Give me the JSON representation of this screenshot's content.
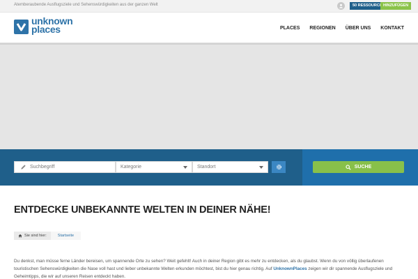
{
  "topbar": {
    "tagline": "Atemberaubende Ausflugsziele und Sehenswürdigkeiten aus der ganzen Welt",
    "resources_label": "50 RESSOURCEN",
    "add_label": "HINZUFÜGEN"
  },
  "header": {
    "logo_line1": "unknown",
    "logo_line2": "places",
    "nav": [
      "PLACES",
      "REGIONEN",
      "ÜBER UNS",
      "KONTAKT"
    ]
  },
  "search": {
    "keyword_placeholder": "Suchbegriff",
    "category_label": "Kategorie",
    "location_label": "Standort",
    "submit_label": "SUCHE"
  },
  "main": {
    "title": "ENTDECKE UNBEKANNTE WELTEN IN DEINER NÄHE!",
    "breadcrumb_prefix": "Sie sind hier:",
    "breadcrumb_current": "Startseite",
    "intro_part1": "Du denkst, man müsse ferne Länder bereisen, um spannende Orte zu sehen? Weit gefehlt! Auch in deiner Region gibt es mehr zu entdecken, als du glaubst. Wenn du von völlig überlaufenen touristischen Sehenswürdigkeiten die Nase voll hast und lieber unbekannte Welten erkunden möchtest, bist du hier genau richtig. Auf ",
    "intro_brand": "UnknownPlaces",
    "intro_part2": " zeigen wir dir spannende Ausflugsziele und Geheimtipps, die wir auf unseren Reisen entdeckt haben."
  },
  "colors": {
    "brand_blue": "#2e73a8",
    "search_band": "#1f6fab",
    "search_panel": "#1f5f8a",
    "accent_green": "#88c04a"
  }
}
